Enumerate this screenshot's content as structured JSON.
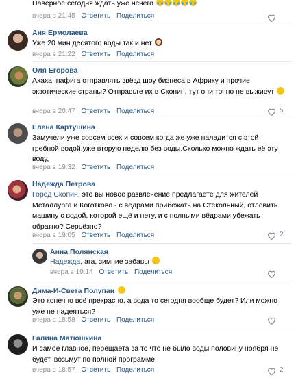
{
  "comments": [
    {
      "author": "",
      "text": "Наверное сегодня ждать уже нечего",
      "time": "вчера в 21:45",
      "reply": "Ответить",
      "share": "Поделиться",
      "likes": "",
      "emoji": "crying-face x5"
    },
    {
      "author": "Аня Ермолаева",
      "text": "Уже 20 мин десятого воды так и нет",
      "time": "вчера в 21:22",
      "reply": "Ответить",
      "share": "Поделиться",
      "likes": "",
      "emoji": "woman-facepalm"
    },
    {
      "author": "Оля Егорова",
      "text": "Ахаха, нафига отправлять звёзд шоу бизнеса в Африку и прочие экзотические страны? Отправьте их в Скопин, тут они точно не выживут",
      "time": "вчера в 20:47",
      "reply": "Ответить",
      "share": "Поделиться",
      "likes": "5",
      "emoji": "grinning-face"
    },
    {
      "author": "Елена Картушина",
      "text": "Замучели уже совсем всех и совсем когда же уже наладится с этой гребной водой,уже вторую неделю без воды.Сколько можно ждать её эту воду,",
      "time": "вчера в 19:32",
      "reply": "Ответить",
      "share": "Поделиться",
      "likes": "",
      "emoji": ""
    },
    {
      "author": "Надежда Петрова",
      "reply_to": "Город Скопин",
      "text": ", это вы новое развлечение предлагаете для жителей Металлурга и Коготково - с вёдрами прибежать на Стекольный, отловить машину с водой, которой ещё и нету, и с полными вёдрами убежать обратно? Серьёзно?",
      "time": "вчера в 19:05",
      "reply": "Ответить",
      "share": "Поделиться",
      "likes": "2",
      "emoji": ""
    },
    {
      "author": "Анна Полянская",
      "reply_to": "Надежда",
      "text": ", ага, зимние забавы",
      "time": "вчера в 19:14",
      "reply": "Ответить",
      "share": "Поделиться",
      "likes": "",
      "emoji": "sly-face"
    },
    {
      "author": "Дима-И-Света Полупан",
      "text": "Это конечно всё прекрасно, а вода то сегодня вообще будет? Или можно уже не надеяться?",
      "time": "вчера в 18:58",
      "reply": "Ответить",
      "share": "Поделиться",
      "likes": "",
      "emoji": "sunglasses-face"
    },
    {
      "author": "Галина Матюшкина",
      "text": "И самое главное, перещаета за то что не было воды половину ноября не будет, возьмут по полной программе.",
      "time": "вчера в 18:57",
      "reply": "Ответить",
      "share": "Поделиться",
      "likes": "2",
      "emoji": ""
    }
  ],
  "colors": {
    "link": "#2a5885",
    "meta": "#939393",
    "separator": "#e7e8ec",
    "like_icon": "#828a99"
  }
}
